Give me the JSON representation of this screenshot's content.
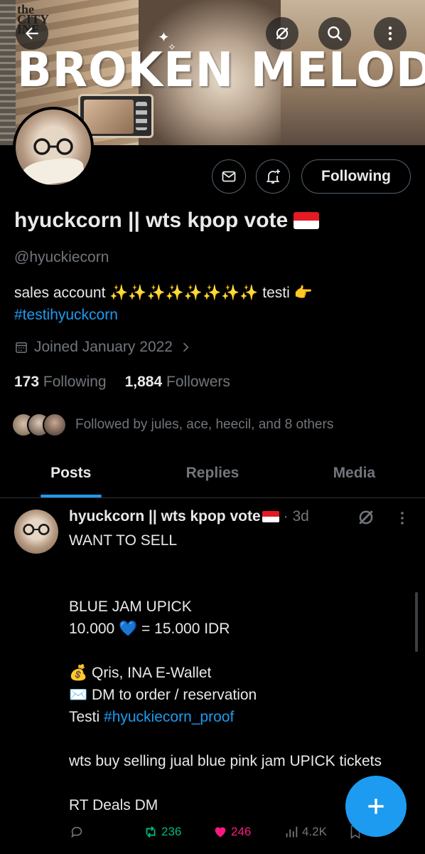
{
  "banner": {
    "title": "BROKEN MELODIES",
    "sign_text": "the CITY INF"
  },
  "topbar": {
    "back_icon": "back-arrow-icon",
    "grok_icon": "grok-icon",
    "search_icon": "search-icon",
    "more_icon": "more-vertical-icon"
  },
  "profile": {
    "display_name": "hyuckcorn || wts kpop vote",
    "flag": "Indonesia flag",
    "handle": "@hyuckiecorn",
    "bio_line1": "sales account ✨✨✨✨✨✨✨✨ testi 👉",
    "bio_hashtag": "#testihyuckcorn",
    "joined": "Joined January 2022",
    "following_count": "173",
    "following_label": "Following",
    "followers_count": "1,884",
    "followers_label": "Followers",
    "followed_by": "Followed by jules, ace, heecil, and 8 others"
  },
  "actions": {
    "follow_label": "Following",
    "message_icon": "envelope-icon",
    "notify_icon": "bell-plus-icon"
  },
  "tabs": [
    {
      "label": "Posts",
      "active": true
    },
    {
      "label": "Replies",
      "active": false
    },
    {
      "label": "Media",
      "active": false
    }
  ],
  "post": {
    "author": "hyuckcorn || wts kpop vote",
    "time": "· 3d",
    "lines": {
      "l1": "WANT TO SELL",
      "l2": "BLUE JAM UPICK",
      "l3": "10.000 💙 = 15.000 IDR",
      "l4": "💰 Qris, INA E-Wallet",
      "l5": "✉️ DM to order / reservation",
      "l6_prefix": "Testi ",
      "l6_tag": "#hyuckiecorn_proof",
      "l7": "wts buy selling jual blue pink jam UPICK tickets",
      "l8": "RT Deals DM"
    },
    "reply_count": "",
    "retweet_count": "236",
    "like_count": "246",
    "view_count": "4.2K"
  },
  "colors": {
    "accent": "#1d9bf0",
    "retweet": "#00ba7c",
    "like": "#f91880",
    "muted": "#71767b"
  }
}
